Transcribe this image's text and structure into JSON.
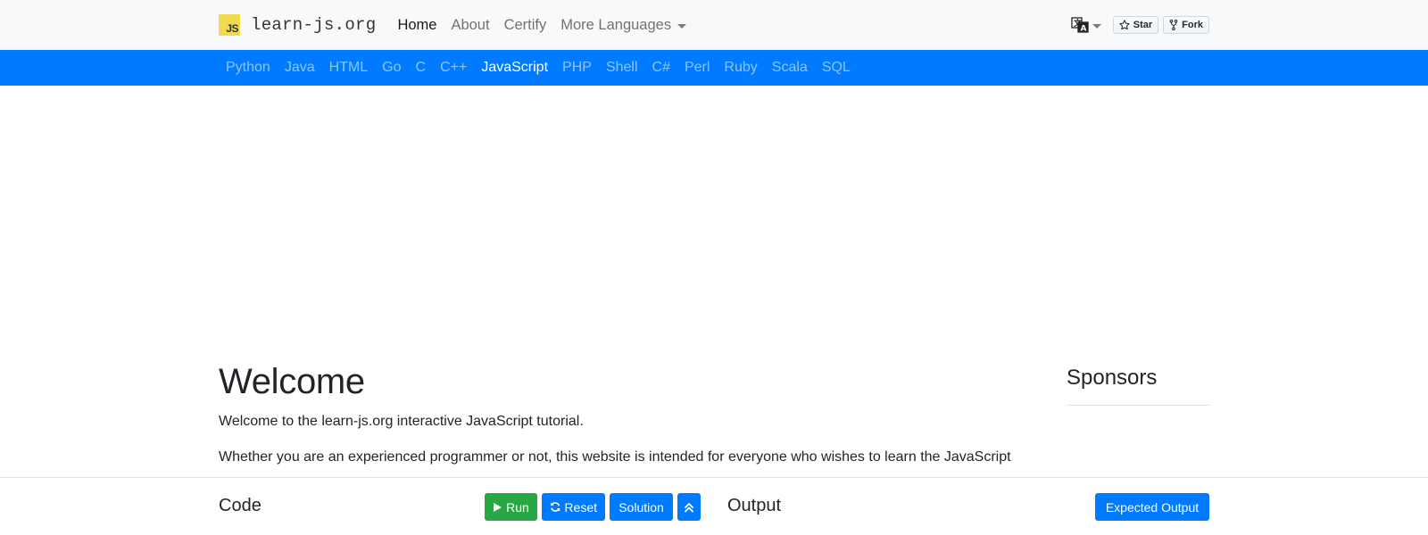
{
  "brand": {
    "logo_text": "JS",
    "name": "learn-js.org"
  },
  "topnav": {
    "items": [
      {
        "label": "Home",
        "active": true
      },
      {
        "label": "About",
        "active": false
      },
      {
        "label": "Certify",
        "active": false
      },
      {
        "label": "More Languages",
        "active": false,
        "dropdown": true
      }
    ]
  },
  "github": {
    "star_label": "Star",
    "fork_label": "Fork"
  },
  "languages": {
    "items": [
      "Python",
      "Java",
      "HTML",
      "Go",
      "C",
      "C++",
      "JavaScript",
      "PHP",
      "Shell",
      "C#",
      "Perl",
      "Ruby",
      "Scala",
      "SQL"
    ],
    "active": "JavaScript"
  },
  "content": {
    "title": "Welcome",
    "paragraphs": [
      "Welcome to the learn-js.org interactive JavaScript tutorial.",
      "Whether you are an experienced programmer or not, this website is intended for everyone who wishes to learn the JavaScript"
    ]
  },
  "sidebar": {
    "title": "Sponsors"
  },
  "bottombar": {
    "code_label": "Code",
    "run_label": "Run",
    "reset_label": "Reset",
    "solution_label": "Solution",
    "output_label": "Output",
    "expected_output_label": "Expected Output"
  },
  "colors": {
    "primary": "#007bff",
    "success": "#28a745",
    "navbar_bg": "#f8f9fa",
    "js_logo": "#f0db4f"
  }
}
